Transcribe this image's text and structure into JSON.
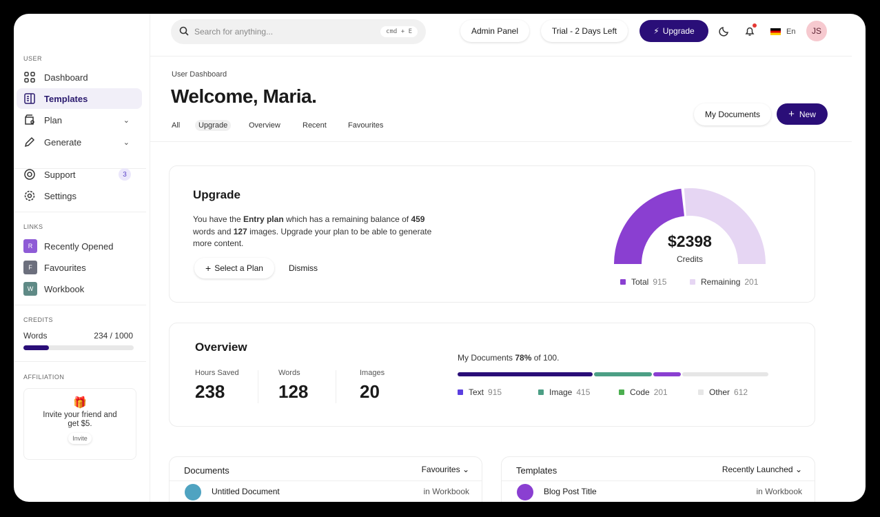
{
  "header": {
    "search_placeholder": "Search for anything...",
    "shortcut": "cmd + E",
    "admin": "Admin Panel",
    "trial": "Trial - 2 Days Left",
    "upgrade": "Upgrade",
    "lang": "En",
    "avatar": "JS"
  },
  "sidebar": {
    "user_label": "USER",
    "items": [
      {
        "label": "Dashboard"
      },
      {
        "label": "Templates"
      },
      {
        "label": "Plan"
      },
      {
        "label": "Generate"
      },
      {
        "label": "Support",
        "badge": "3"
      },
      {
        "label": "Settings"
      }
    ],
    "links_label": "LINKS",
    "links": [
      {
        "letter": "R",
        "label": "Recently Opened",
        "color": "#8e5bd6"
      },
      {
        "letter": "F",
        "label": "Favourites",
        "color": "#6c6f7d"
      },
      {
        "letter": "W",
        "label": "Workbook",
        "color": "#5f8a86"
      }
    ],
    "credits_label": "CREDITS",
    "credits_name": "Words",
    "credits_value": "234 / 1000",
    "credits_progress": 0.234,
    "affiliation_label": "AFFILIATION",
    "invite_text": "Invite your friend and get $5.",
    "invite_button": "Invite"
  },
  "page": {
    "breadcrumb": "User Dashboard",
    "title": "Welcome, Maria.",
    "my_docs": "My Documents",
    "new": "New",
    "tabs": [
      "All",
      "Upgrade",
      "Overview",
      "Recent",
      "Favourites"
    ]
  },
  "upgrade": {
    "title": "Upgrade",
    "t1": "You have the ",
    "plan": "Entry plan",
    "t2": " which has a remaining balance of ",
    "words": "459",
    "t3": " words and ",
    "images": "127",
    "t4": " images. Upgrade your plan to be able to generate more content.",
    "select": "Select a Plan",
    "dismiss": "Dismiss",
    "amount": "$2398",
    "amount_label": "Credits",
    "legend": [
      {
        "label": "Total",
        "value": "915",
        "color": "#8a3fd1"
      },
      {
        "label": "Remaining",
        "value": "201",
        "color": "#e6d6f3"
      }
    ]
  },
  "overview": {
    "title": "Overview",
    "stats": [
      {
        "label": "Hours Saved",
        "value": "238"
      },
      {
        "label": "Words",
        "value": "128"
      },
      {
        "label": "Images",
        "value": "20"
      }
    ],
    "docs_t1": "My Documents ",
    "docs_pct": "78%",
    "docs_t2": " of 100.",
    "segments": [
      {
        "label": "Text",
        "value": "915",
        "color": "#2a0e78",
        "legend_color": "#5b3fe0"
      },
      {
        "label": "Image",
        "value": "415",
        "color": "#4c9f85"
      },
      {
        "label": "Code",
        "value": "201",
        "color": "#8a3fd1",
        "legend_color": "#4caf50"
      },
      {
        "label": "Other",
        "value": "612",
        "color": "#e6e6e6"
      }
    ]
  },
  "documents": {
    "title": "Documents",
    "filter": "Favourites",
    "row": "Untitled Document",
    "row_loc": "in Workbook"
  },
  "templates": {
    "title": "Templates",
    "filter": "Recently Launched",
    "row": "Blog Post Title",
    "row_loc": "in Workbook"
  }
}
